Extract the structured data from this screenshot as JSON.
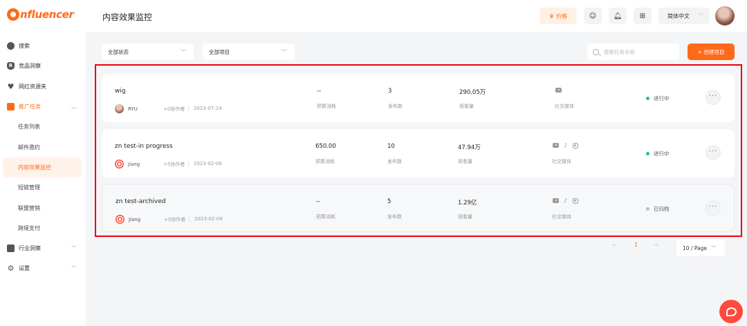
{
  "brand": {
    "logo_text": "nfluencer"
  },
  "sidebar": {
    "items": [
      {
        "label": "搜索"
      },
      {
        "label": "竞品洞察"
      },
      {
        "label": "网红资源夹"
      },
      {
        "label": "推广任务"
      },
      {
        "label": "任务列表"
      },
      {
        "label": "邮件邀约"
      },
      {
        "label": "内容效果监控"
      },
      {
        "label": "短链管理"
      },
      {
        "label": "联盟营销"
      },
      {
        "label": "跨境支付"
      },
      {
        "label": "行业洞察"
      },
      {
        "label": "设置"
      }
    ]
  },
  "header": {
    "title": "内容效果监控",
    "price_label": "价格",
    "language": "简体中文"
  },
  "filters": {
    "status": "全部状态",
    "project": "全部项目",
    "search_placeholder": "搜索任务名称",
    "create_label": "+ 创建项目"
  },
  "projects": [
    {
      "name": "wig",
      "owner": "RYU",
      "collaborators": "+0协作者",
      "date": "2023-07-14",
      "budget": "--",
      "budget_label": "预算消耗",
      "posts": "3",
      "posts_label": "发布数",
      "views": "290.05万",
      "views_label": "观看量",
      "platforms": [
        "youtube-icon"
      ],
      "platforms_label": "社交媒体",
      "status": "进行中",
      "status_color": "#2bc46b"
    },
    {
      "name": "zn test-in progress",
      "owner": "Jiang",
      "collaborators": "+5协作者",
      "date": "2023-02-08",
      "budget": "650.00",
      "budget_label": "预算消耗",
      "posts": "10",
      "posts_label": "发布数",
      "views": "47.94万",
      "views_label": "观看量",
      "platforms": [
        "youtube-icon",
        "tiktok-icon",
        "instagram-icon"
      ],
      "platforms_label": "社交媒体",
      "status": "进行中",
      "status_color": "#2bc46b"
    },
    {
      "name": "zn test-archived",
      "owner": "Jiang",
      "collaborators": "+5协作者",
      "date": "2023-02-09",
      "budget": "--",
      "budget_label": "预算消耗",
      "posts": "5",
      "posts_label": "发布数",
      "views": "1.29亿",
      "views_label": "观看量",
      "platforms": [
        "youtube-icon",
        "tiktok-icon",
        "instagram-icon"
      ],
      "platforms_label": "社交媒体",
      "status": "已归档",
      "status_color": "#bbbbbb"
    }
  ],
  "pagination": {
    "prev": "←",
    "current": "1",
    "next": "→",
    "page_size": "10 / Page"
  },
  "colors": {
    "accent": "#ff6a1a",
    "highlight": "#e8000c"
  }
}
